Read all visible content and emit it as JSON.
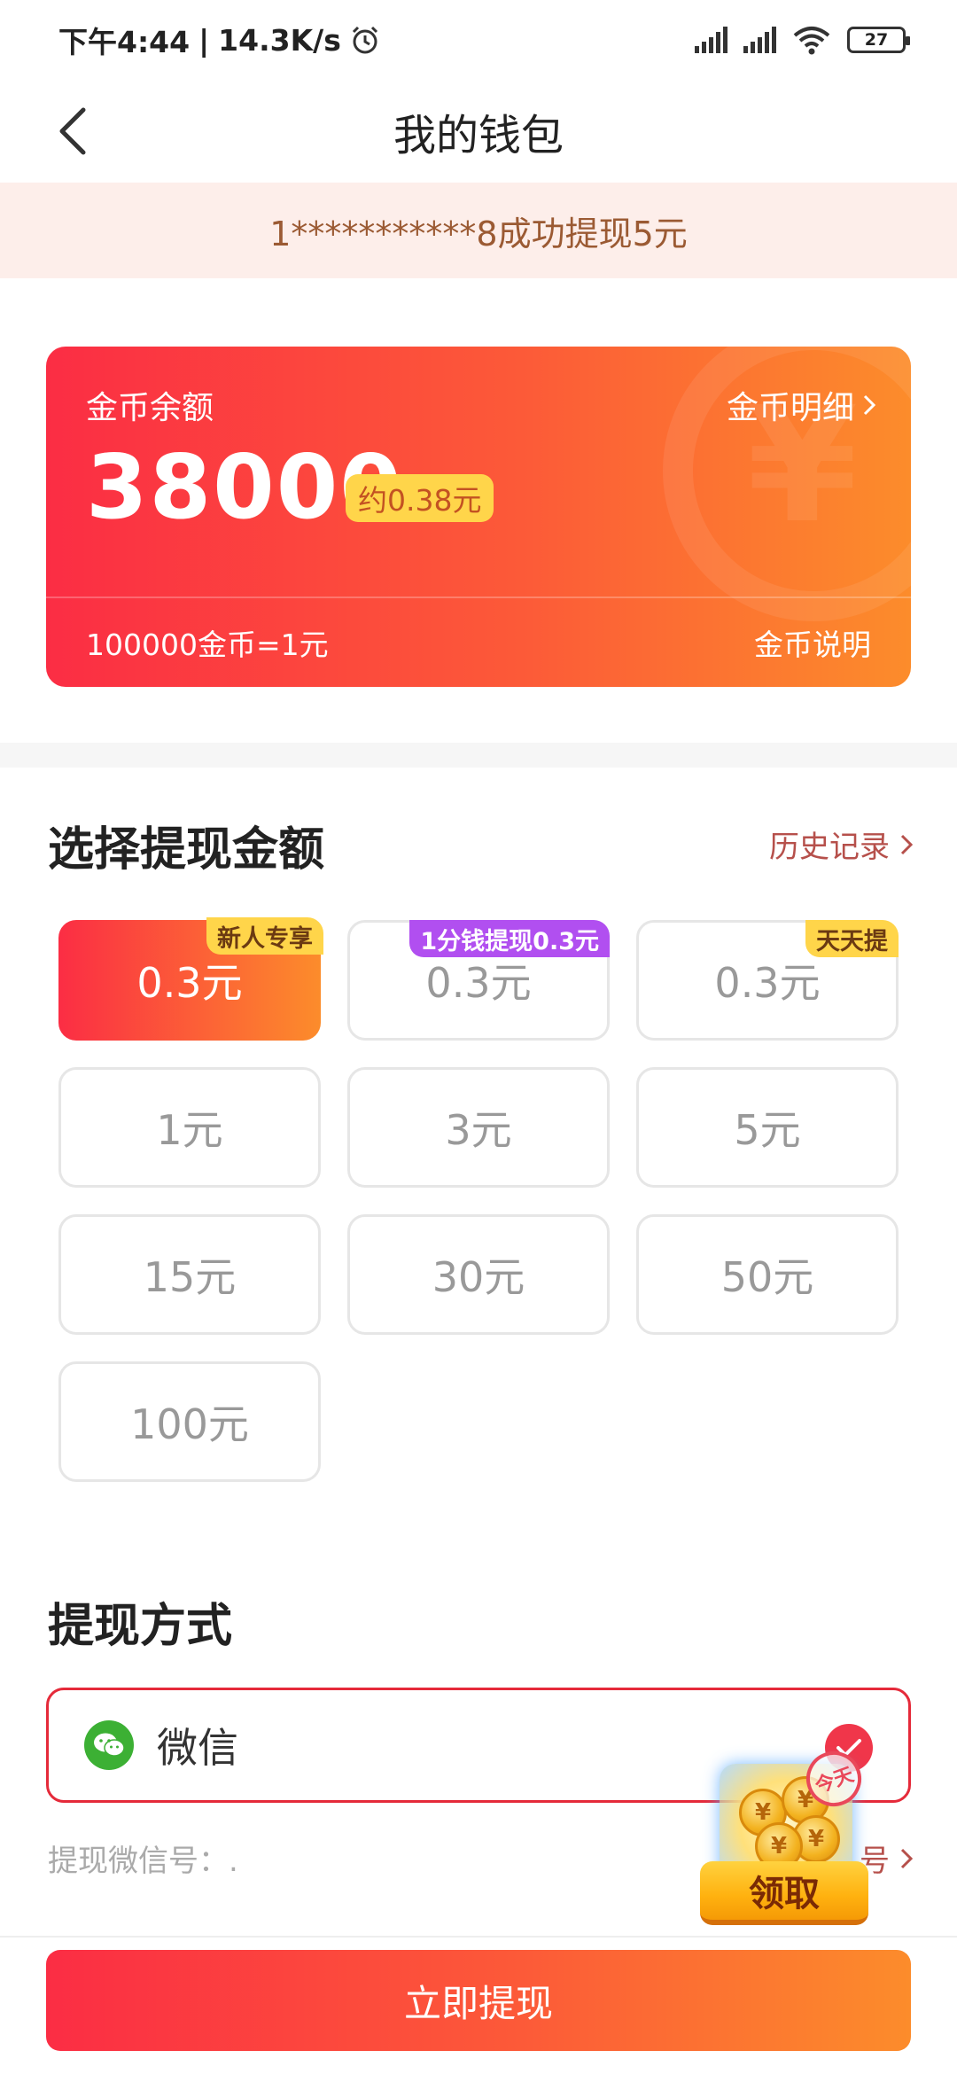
{
  "status_bar": {
    "time": "下午4:44",
    "net_speed": "14.3K/s",
    "battery": "27"
  },
  "nav": {
    "title": "我的钱包"
  },
  "notice": {
    "text": "1***********8成功提现5元"
  },
  "balance_card": {
    "label": "金币余额",
    "detail_link": "金币明细",
    "balance": "38000",
    "approx": "约0.38元",
    "rate": "100000金币=1元",
    "explain_link": "金币说明"
  },
  "withdraw": {
    "title": "选择提现金额",
    "history_link": "历史记录",
    "amounts": [
      {
        "label": "0.3元",
        "tag": "新人专享",
        "selected": true
      },
      {
        "label": "0.3元",
        "tag": "1分钱提现0.3元"
      },
      {
        "label": "0.3元",
        "tag": "天天提"
      },
      {
        "label": "1元"
      },
      {
        "label": "3元"
      },
      {
        "label": "5元"
      },
      {
        "label": "15元"
      },
      {
        "label": "30元"
      },
      {
        "label": "50元"
      },
      {
        "label": "100元"
      }
    ]
  },
  "payment": {
    "title": "提现方式",
    "method_label": "微信",
    "account_label": "提现微信号：.",
    "bind_link_partial": "号"
  },
  "promo": {
    "stamp": "今天",
    "button_label": "领取"
  },
  "submit_label": "立即提现",
  "colors": {
    "accent_start": "#fb2d44",
    "accent_end": "#fc8c2b",
    "tag_yellow": "#ffd54a",
    "tag_purple": "#b14ff0",
    "wechat_green": "#3cb034"
  }
}
